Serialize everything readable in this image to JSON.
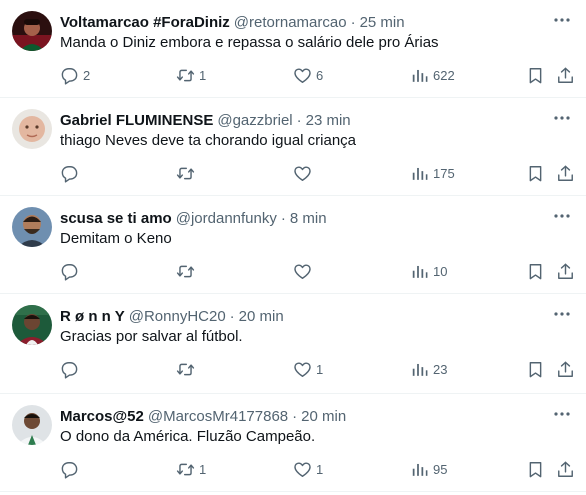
{
  "colors": {
    "text": "#0f1419",
    "secondary": "#536471",
    "divider": "#eff3f4"
  },
  "icons": {
    "more": "more-horizontal-icon",
    "reply": "reply-icon",
    "retweet": "retweet-icon",
    "like": "heart-icon",
    "views": "views-icon",
    "bookmark": "bookmark-icon",
    "share": "share-icon"
  },
  "tweets": [
    {
      "name": "Voltamarcao #ForaDiniz",
      "handle": "@retornamarcao",
      "separator": "·",
      "time": "25 min",
      "text": "Manda o Diniz embora e repassa o salário dele pro Árias",
      "replies": "2",
      "retweets": "1",
      "likes": "6",
      "views": "622"
    },
    {
      "name": "Gabriel FLUMINENSE",
      "handle": "@gazzbriel",
      "separator": "·",
      "time": "23 min",
      "text": "thiago Neves deve ta chorando igual criança",
      "replies": "",
      "retweets": "",
      "likes": "",
      "views": "175"
    },
    {
      "name": "scusa se ti amo",
      "handle": "@jordannfunky",
      "separator": "·",
      "time": "8 min",
      "text": "Demitam o Keno",
      "replies": "",
      "retweets": "",
      "likes": "",
      "views": "10"
    },
    {
      "name": "R ø n n Y",
      "handle": "@RonnyHC20",
      "separator": "·",
      "time": "20 min",
      "text": "Gracias por salvar al fútbol.",
      "replies": "",
      "retweets": "",
      "likes": "1",
      "views": "23"
    },
    {
      "name": "Marcos@52",
      "handle": "@MarcosMr4177868",
      "separator": "·",
      "time": "20 min",
      "text": "O dono da América. Fluzão Campeão.",
      "replies": "",
      "retweets": "1",
      "likes": "1",
      "views": "95"
    }
  ]
}
